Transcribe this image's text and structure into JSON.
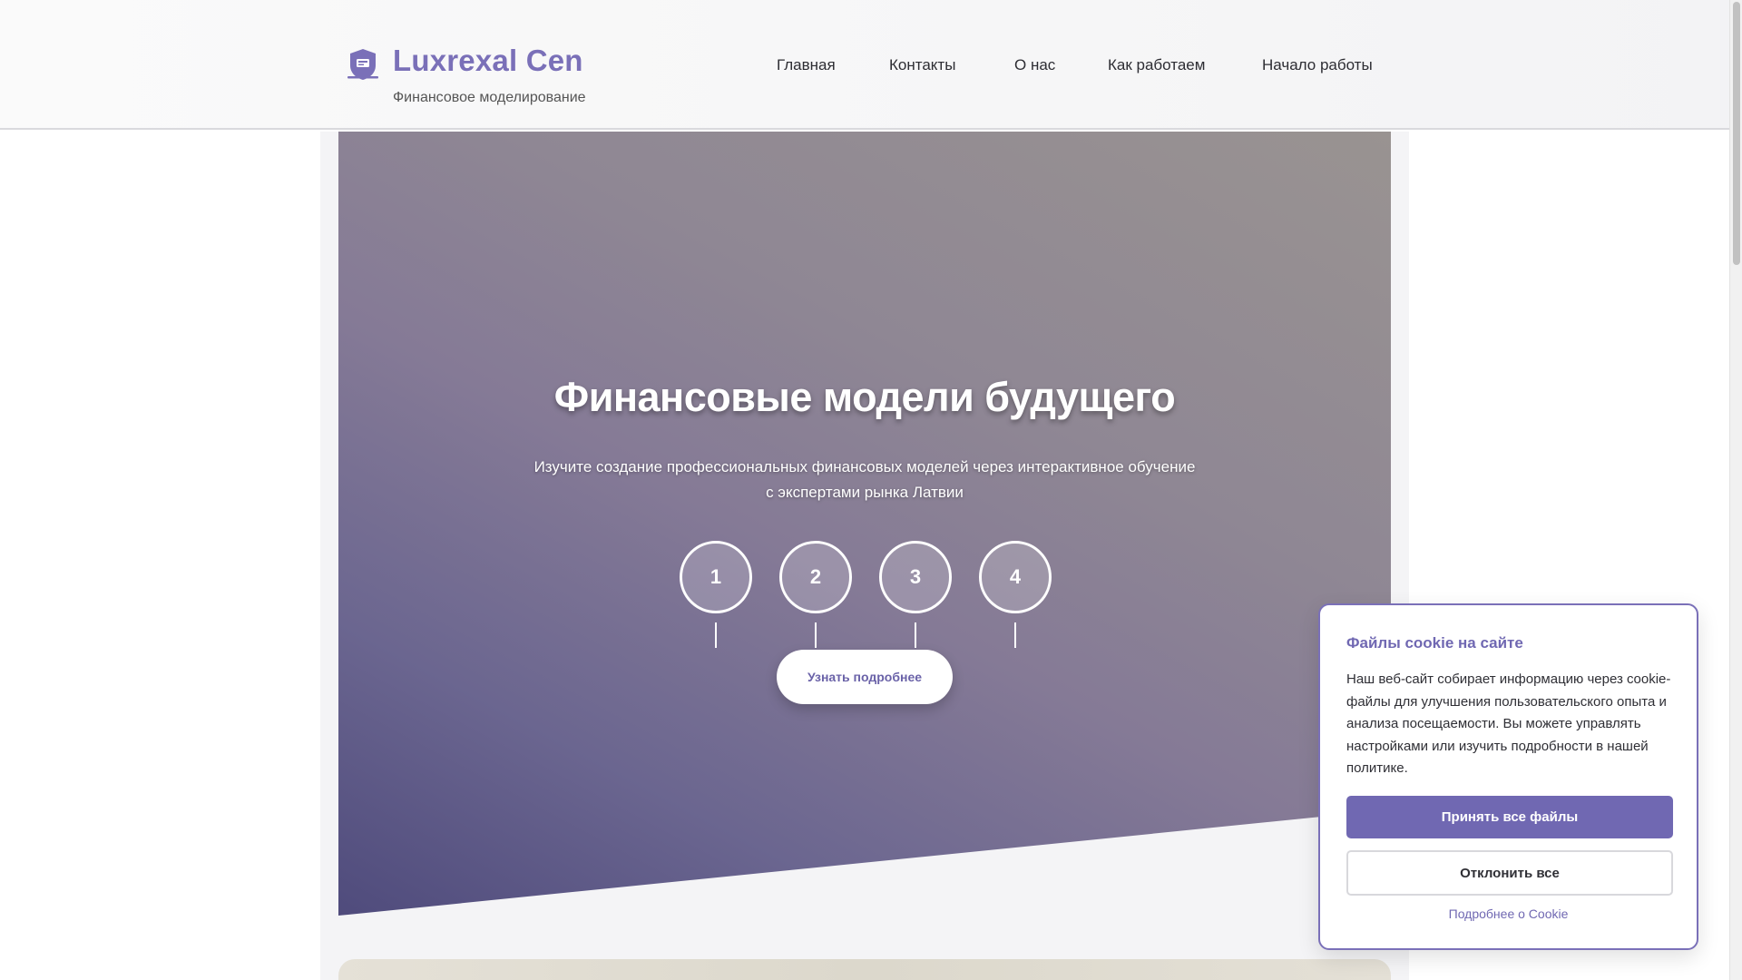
{
  "header": {
    "brand_title": "Luxrexal Cen",
    "brand_subtitle": "Финансовое моделирование",
    "logo_icon": "shield-icon",
    "nav": [
      {
        "label": "Главная"
      },
      {
        "label": "Контакты"
      },
      {
        "label": "О нас"
      },
      {
        "label": "Как работаем"
      },
      {
        "label": "Начало работы"
      }
    ]
  },
  "hero": {
    "title": "Финансовые модели будущего",
    "subtitle": "Изучите создание профессиональных финансовых моделей через интерактивное обучение с экспертами рынка Латвии",
    "steps": [
      "1",
      "2",
      "3",
      "4"
    ],
    "cta_label": "Узнать подробнее"
  },
  "cookie": {
    "title": "Файлы cookie на сайте",
    "text": "Наш веб-сайт собирает информацию через cookie-файлы для улучшения пользовательского опыта и анализа посещаемости. Вы можете управлять настройками или изучить подробности в нашей политике.",
    "accept_label": "Принять все файлы",
    "decline_label": "Отклонить все",
    "more_label": "Подробнее о Cookie"
  },
  "colors": {
    "accent": "#7068b2",
    "brand": "#7a70b8"
  }
}
